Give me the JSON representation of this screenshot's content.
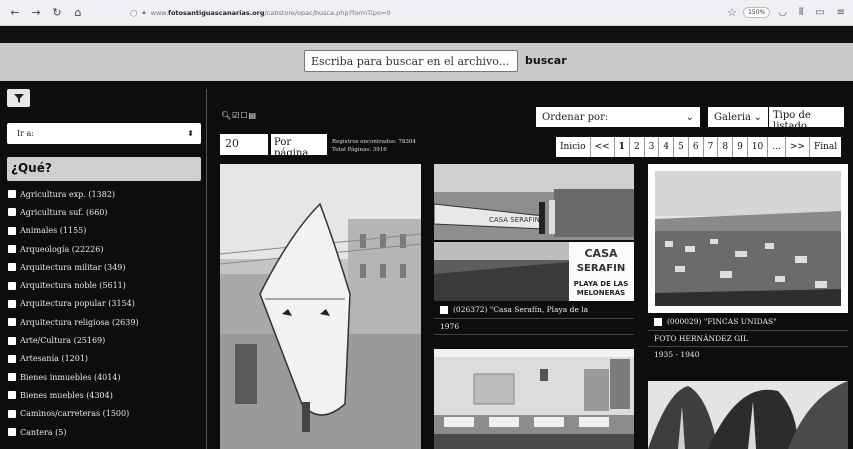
{
  "browser": {
    "url_prefix": "www.",
    "url_host": "fotosantiguascanarias.org",
    "url_path": "/cabstore/opac/busca.php?formTipo=0",
    "zoom": "150%"
  },
  "search": {
    "placeholder": "Escriba para buscar en el archivo...",
    "button_label": "buscar"
  },
  "sidebar": {
    "ir_a_label": "Ir a:",
    "que_title": "¿Qué?",
    "categories": [
      "Agricultura exp. (1382)",
      "Agricultura suf. (660)",
      "Animales (1155)",
      "Arqueología (22226)",
      "Arquitectura militar (349)",
      "Arquitectura noble (5611)",
      "Arquitectura popular (3154)",
      "Arquitectura religiosa (2639)",
      "Arte/Cultura (25169)",
      "Artesanía (1201)",
      "Bienes inmuebles (4014)",
      "Bienes muebles (4304)",
      "Caminos/carreteras (1500)",
      "Cantera (5)"
    ]
  },
  "toolbar": {
    "per_page_value": "20",
    "per_page_label": "Por página",
    "records_found": "Registros encontrados: 78304",
    "total_pages": "Total Páginas: 3916",
    "order_label": "Ordenar por:",
    "view_option": "Galeria",
    "list_type_label": "Tipo de listado"
  },
  "pagination": [
    "Inicio",
    "<<",
    "1",
    "2",
    "3",
    "4",
    "5",
    "6",
    "7",
    "8",
    "9",
    "10",
    "...",
    ">>",
    "Final"
  ],
  "gallery": {
    "card2": {
      "sign_line1": "CASA",
      "sign_line2": "SERAFIN",
      "sign_line3": "PLAYA DE LAS",
      "sign_line4": "MELONERAS",
      "boat_text": "CASA SERAFIN",
      "caption": "(026372) \"Casa Serafín, Playa de la",
      "year": "1976"
    },
    "card3": {
      "caption": "(000029) \"FINCAS UNIDAS\"",
      "author": "FOTO HERNÁNDEZ GIL",
      "years": "1935 - 1940"
    }
  }
}
